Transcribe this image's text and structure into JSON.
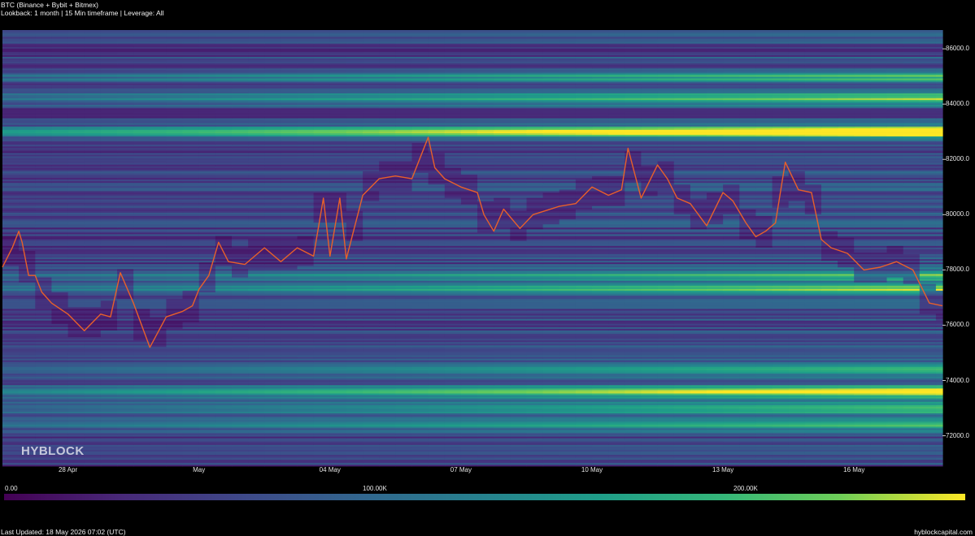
{
  "header": {
    "title": "BTC (Binance + Bybit + Bitmex)",
    "subtitle": "Lookback: 1 month | 15 Min timeframe | Leverage: All"
  },
  "watermark": "HYBLOCK",
  "colorbar": {
    "labels": [
      "0.00",
      "100.00K",
      "200.00K"
    ],
    "colors": [
      "#440154",
      "#482878",
      "#3e4989",
      "#31688e",
      "#26828e",
      "#1f9e89",
      "#35b779",
      "#6ece58",
      "#fde725"
    ]
  },
  "footer": {
    "last_updated": "Last Updated: 18 May 2026 07:02 (UTC)",
    "brand": "hyblockcapital.com"
  },
  "chart_data": {
    "type": "heatmap",
    "title": "BTC (Binance + Bybit + Bitmex)",
    "x_ticks": [
      "28 Apr",
      "May",
      "04 May",
      "07 May",
      "10 May",
      "13 May",
      "16 May"
    ],
    "x_tick_days": [
      2,
      6,
      10,
      14,
      18,
      22,
      26
    ],
    "x_range_days": [
      0,
      28.7
    ],
    "y_ticks": [
      "72000.0",
      "74000.0",
      "76000.0",
      "78000.0",
      "80000.0",
      "82000.0",
      "84000.0",
      "86000.0"
    ],
    "y_tick_values": [
      72000,
      74000,
      76000,
      78000,
      80000,
      82000,
      84000,
      86000
    ],
    "ylim": [
      70900,
      86650
    ],
    "colorscale_max": 230000,
    "price_series": {
      "color": "#e8602a",
      "days": [
        0,
        0.3,
        0.5,
        0.6,
        0.8,
        1.0,
        1.2,
        1.5,
        2.0,
        2.5,
        3.0,
        3.3,
        3.6,
        4.0,
        4.5,
        5.0,
        5.5,
        5.8,
        6.0,
        6.3,
        6.6,
        6.9,
        7.4,
        8.0,
        8.5,
        9.0,
        9.5,
        9.8,
        10.0,
        10.3,
        10.5,
        11.0,
        11.5,
        12.0,
        12.5,
        13.0,
        13.2,
        13.5,
        14.0,
        14.5,
        14.7,
        15.0,
        15.3,
        15.8,
        16.2,
        17.0,
        17.5,
        18.0,
        18.5,
        18.9,
        19.1,
        19.5,
        20.0,
        20.3,
        20.6,
        21.0,
        21.5,
        22.0,
        22.3,
        22.7,
        23.0,
        23.3,
        23.6,
        23.9,
        24.3,
        24.7,
        25.0,
        25.3,
        25.8,
        26.3,
        26.8,
        27.3,
        27.8,
        28.3,
        28.7
      ],
      "prices": [
        78100,
        78800,
        79400,
        79000,
        77800,
        77800,
        77200,
        76800,
        76400,
        75800,
        76400,
        76300,
        77900,
        76800,
        75200,
        76300,
        76500,
        76700,
        77300,
        77800,
        79000,
        78300,
        78200,
        78800,
        78300,
        78800,
        78500,
        80600,
        78500,
        80600,
        78400,
        80700,
        81300,
        81400,
        81300,
        82800,
        81700,
        81300,
        81000,
        80800,
        80000,
        79400,
        80200,
        79500,
        80000,
        80300,
        80400,
        81000,
        80700,
        80900,
        82400,
        80600,
        81800,
        81300,
        80600,
        80400,
        79600,
        80800,
        80500,
        79700,
        79200,
        79400,
        79700,
        81900,
        80900,
        80800,
        79100,
        78800,
        78600,
        78000,
        78100,
        78300,
        78000,
        76800,
        76700
      ]
    }
  }
}
